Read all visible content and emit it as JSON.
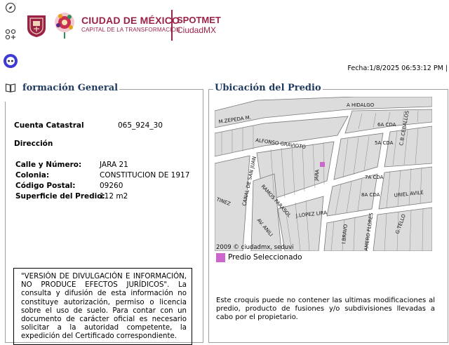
{
  "header": {
    "brand_title": "CIUDAD DE MÉXICO",
    "brand_subtitle": "CAPITAL DE LA TRANSFORMACIÓN",
    "app_title": "SPOTMET",
    "app_subtitle": "CiudadMX",
    "brand_color": "#9b2247",
    "fecha": "Fecha:1/8/2025 06:53:12 PM |"
  },
  "sidebar": {
    "icons": [
      "compass-icon",
      "grid-icon",
      "assistant-icon",
      "book-icon"
    ]
  },
  "general": {
    "legend": "formación General",
    "cuenta_label": "Cuenta Catastral",
    "cuenta_value": "065_924_30",
    "direccion_label": "Dirección",
    "calle_label": "Calle y Número:",
    "calle_value": "JARA 21",
    "colonia_label": "Colonia:",
    "colonia_value": "CONSTITUCION DE 1917",
    "cp_label": "Código Postal:",
    "cp_value": "09260",
    "superficie_label": "Superficie del Predio:",
    "superficie_value": "112 m2",
    "disclaimer": "\"VERSIÓN DE DIVULGACIÓN E INFORMACIÓN, NO PRODUCE EFECTOS JURÍDICOS\". La consulta y difusión de esta información no constituye autorización, permiso o licencia sobre el uso de suelo. Para contar con un documento de carácter oficial es necesario solicitar a la autoridad competente, la expedición del Certificado correspondiente."
  },
  "ubicacion": {
    "legend": "Ubicación del Predio",
    "map_copyright": "2009 © ciudadmx, seduvi",
    "legend_label": "Predio Seleccionado",
    "predio_color": "#cc66cc",
    "note": "Este croquis puede no contener las ultimas modificaciones al predio, producto de fusiones y/o subdivisiones llevadas a cabo por el propietario.",
    "streets": {
      "hidalgo": "A HIDALGO",
      "zepeda": "M.ZEPEDA M.",
      "gravioto": "ALFONSO GRAVIOTO",
      "ceballos": "C.B.CEBALLOS",
      "sexta": "6A CDA",
      "quinta": "5A CDA",
      "septima": "7A CDA",
      "octava": "8A CDA",
      "sanjuan": "CANAL DE SAN JUAN",
      "jara": "JARA",
      "parasol": "RAMOS PARASOL",
      "urielavile": "URIEL AVILE",
      "lopez": "J.LOPEZ LIRA",
      "bravo": "I.BRAVO",
      "flores": "AMERO FLORES",
      "tello": "G.TELLO",
      "anili": "AV. ANILI",
      "tinez": "TINEZ"
    }
  }
}
